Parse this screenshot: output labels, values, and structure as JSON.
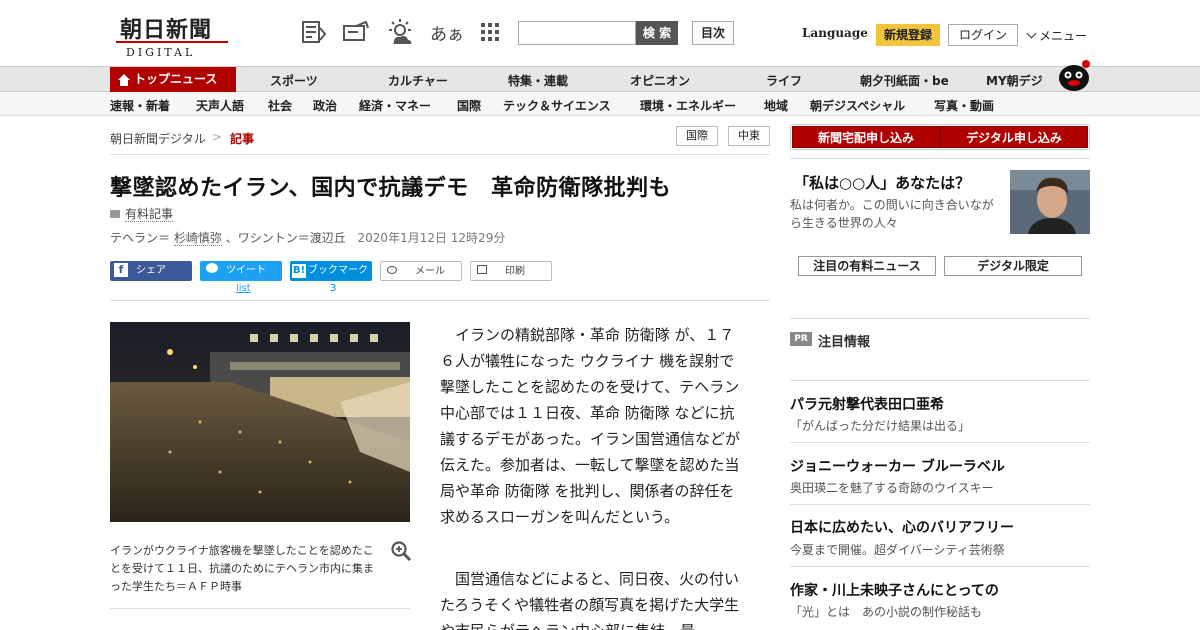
{
  "header": {
    "logo_jp": "朝日新聞",
    "logo_en": "DIGITAL",
    "aa_label": "あぁ",
    "search_placeholder": "",
    "search_label": "検 索",
    "mokuji_label": "目次",
    "language_label": "Language",
    "register_label": "新規登録",
    "login_label": "ログイン",
    "menu_label": "メニュー"
  },
  "nav_primary": {
    "top_label": "トップニュース",
    "items": [
      "スポーツ",
      "カルチャー",
      "特集・連載",
      "オピニオン",
      "ライフ",
      "朝夕刊紙面・be",
      "MY朝デジ"
    ]
  },
  "nav_secondary": {
    "items": [
      "速報・新着",
      "天声人語",
      "社会",
      "政治",
      "経済・マネー",
      "国際",
      "テック＆サイエンス",
      "環境・エネルギー",
      "地域",
      "朝デジスペシャル",
      "写真・動画"
    ]
  },
  "breadcrumb": {
    "home": "朝日新聞デジタル",
    "sep": ">",
    "current": "記事"
  },
  "tags": [
    "国際",
    "中東"
  ],
  "article": {
    "title": "撃墜認めたイラン、国内で抗議デモ　革命防衛隊批判も",
    "paid_label": "有料記事",
    "byline_prefix": "テヘラン＝",
    "byline_author1": "杉崎慎弥",
    "byline_rest": "、ワシントン＝渡辺丘",
    "date": "2020年1月12日 12時29分",
    "photo_caption": "イランがウクライナ旅客機を撃墜したことを認めたことを受けて１１日、抗議のためにテヘラン市内に集まった学生たち＝ＡＦＰ時事",
    "paragraph1": "イランの精鋭部隊・革命 防衛隊 が、１７６人が犠牲になった ウクライナ 機を誤射で撃墜したことを認めたのを受けて、テヘラン中心部では１１日夜、革命 防衛隊 などに抗議するデモがあった。イラン国営通信などが伝えた。参加者は、一転して撃墜を認めた当局や革命 防衛隊 を批判し、関係者の辞任を求めるスローガンを叫んだという。",
    "paragraph2": "国営通信などによると、同日夜、火の付いたろうそくや犠牲者の顔写真を掲げた大学生や市民らがテヘラン中心部に集結。最"
  },
  "share": {
    "facebook": "シェア",
    "twitter": "ツイート",
    "twitter_sub": "list",
    "hatena": "ブックマーク",
    "hatena_count": "3",
    "mail": "メール",
    "print": "印刷"
  },
  "sidebar": {
    "subscribe_paper": "新聞宅配申し込み",
    "subscribe_digital": "デジタル申し込み",
    "promo_title": "「私は○○人」あなたは？",
    "promo_text": "私は何者か。この問いに向き合いながら生きる世界の人々",
    "btn_featured": "注目の有料ニュース",
    "btn_digital": "デジタル限定",
    "pr_badge": "PR",
    "pr_title": "注目情報",
    "items": [
      {
        "title": "パラ元射撃代表田口亜希",
        "sub": "「がんばった分だけ結果は出る」"
      },
      {
        "title": "ジョニーウォーカー ブルーラベル",
        "sub": "奥田瑛二を魅了する奇跡のウイスキー"
      },
      {
        "title": "日本に広めたい、心のバリアフリー",
        "sub": "今夏まで開催。超ダイバーシティ芸術祭"
      },
      {
        "title": "作家・川上未映子さんにとっての",
        "sub": "「光」とは　あの小説の制作秘話も"
      }
    ]
  },
  "colors": {
    "brand_red": "#b00000",
    "register_yellow": "#f3c53c",
    "facebook": "#3b5998",
    "twitter": "#1da1f2",
    "hatena": "#008fde"
  }
}
